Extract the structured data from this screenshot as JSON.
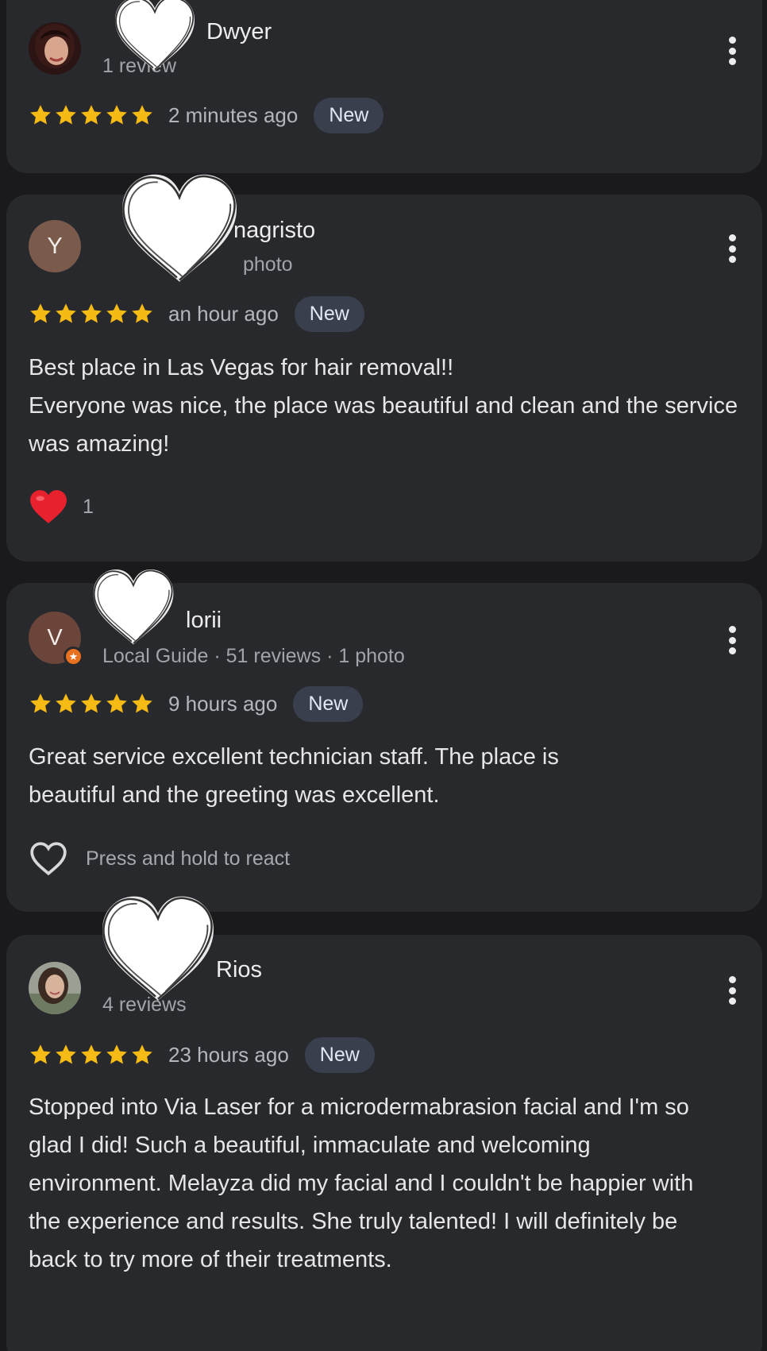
{
  "reviews": [
    {
      "name": "Dwyer",
      "meta": "1 review",
      "time": "2 minutes ago",
      "badge": "New"
    },
    {
      "name": "nagristo",
      "avatar_letter": "Y",
      "meta": "photo",
      "time": "an hour ago",
      "badge": "New",
      "text": "Best place in Las Vegas for hair removal!!\nEveryone was nice, the place was beautiful and clean and the service was amazing!",
      "reaction_count": "1"
    },
    {
      "name": "lorii",
      "avatar_letter": "V",
      "meta": "Local Guide · 51 reviews · 1 photo",
      "time": "9 hours ago",
      "badge": "New",
      "text": "Great service excellent technician staff. The place is beautiful and the greeting was excellent.",
      "react_hint": "Press and hold to react"
    },
    {
      "name": "Rios",
      "meta": "4 reviews",
      "time": "23 hours ago",
      "badge": "New",
      "text": "Stopped into Via Laser for a microdermabrasion facial and I'm so glad I did! Such a beautiful, immaculate and welcoming environment. Melayza did my facial and I couldn't be happier with the experience and results. She truly talented! I will definitely be back to try more of their treatments."
    }
  ],
  "rating_stars": 5,
  "colors": {
    "star": "#f5bb14",
    "badge_bg": "#3a3f4d",
    "card_bg": "#28292d",
    "page_bg": "#1a1a1c",
    "heart": "#e8212e"
  }
}
